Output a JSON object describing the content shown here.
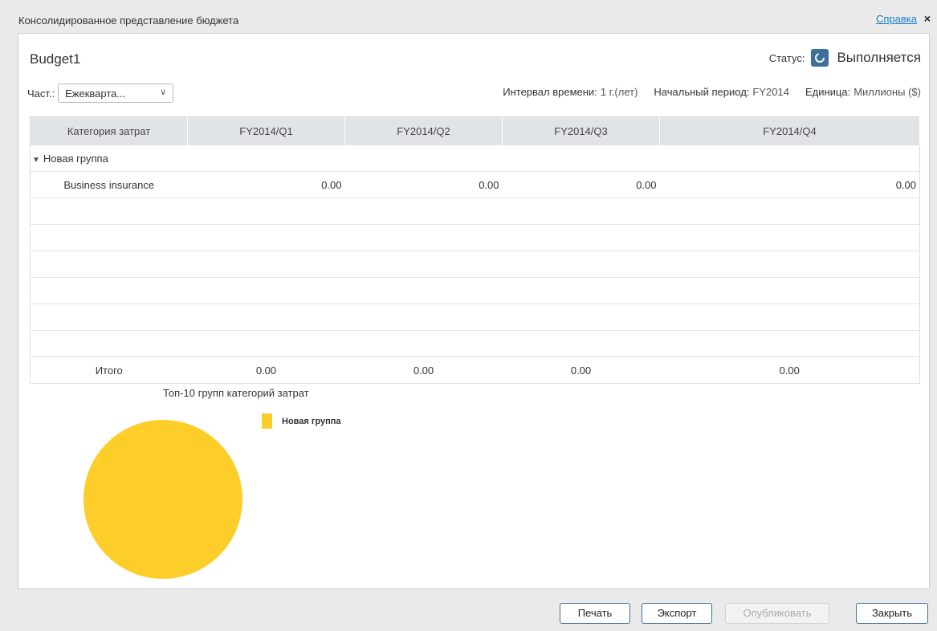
{
  "window": {
    "title": "Консолидированное представление бюджета",
    "help_label": "Справка",
    "close_label": "×"
  },
  "header": {
    "budget_name": "Budget1",
    "status_label": "Статус:",
    "status_value": "Выполняется",
    "frequency_label": "Част.:",
    "frequency_value": "Ежекварта...",
    "interval_label": "Интервал времени:",
    "interval_value": "1 г.(лет)",
    "start_label": "Начальный период:",
    "start_value": "FY2014",
    "unit_label": "Единица:",
    "unit_value": "Миллионы ($)"
  },
  "table": {
    "columns": [
      "Категория затрат",
      "FY2014/Q1",
      "FY2014/Q2",
      "FY2014/Q3",
      "FY2014/Q4"
    ],
    "group_name": "Новая группа",
    "rows": [
      {
        "category": "Business insurance",
        "q1": "0.00",
        "q2": "0.00",
        "q3": "0.00",
        "q4": "0.00"
      }
    ],
    "total_label": "Итого",
    "totals": [
      "0.00",
      "0.00",
      "0.00",
      "0.00"
    ]
  },
  "chart_data": {
    "type": "pie",
    "title": "Топ-10 групп категорий затрат",
    "categories": [
      "Новая группа"
    ],
    "values": [
      100
    ],
    "colors": [
      "#fdcd2a"
    ],
    "legend_position": "top-right"
  },
  "buttons": {
    "print": "Печать",
    "export": "Экспорт",
    "publish": "Опубликовать",
    "close": "Закрыть"
  }
}
